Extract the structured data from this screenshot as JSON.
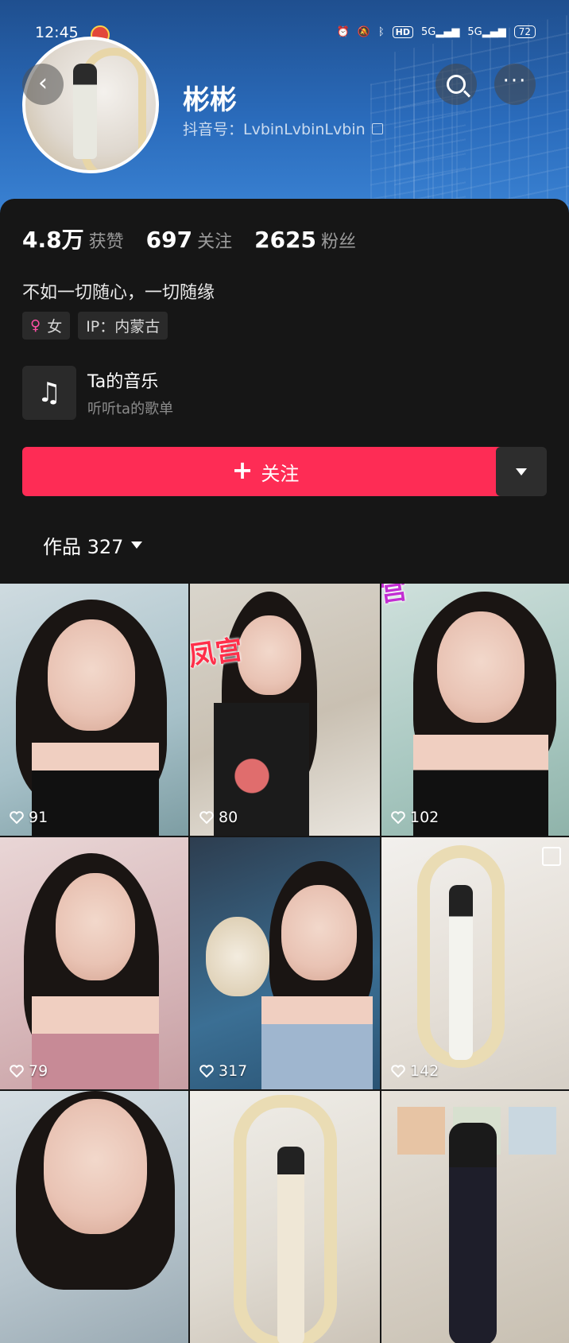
{
  "status_bar": {
    "time": "12:45",
    "hd": "HD",
    "net1": "5G",
    "net2": "5G",
    "battery": "72"
  },
  "profile": {
    "name": "彬彬",
    "douyin_id": "抖音号：LvbinLvbinLvbin",
    "stats": [
      {
        "value": "4.8万",
        "label": "获赞"
      },
      {
        "value": "697",
        "label": "关注"
      },
      {
        "value": "2625",
        "label": "粉丝"
      }
    ],
    "bio": "不如一切随心，一切随缘",
    "gender_tag": "女",
    "ip_tag": "IP：内蒙古"
  },
  "music": {
    "title": "Ta的音乐",
    "subtitle": "听听ta的歌单"
  },
  "buttons": {
    "follow": "关注"
  },
  "works": {
    "label": "作品 327"
  },
  "videos": [
    {
      "likes": "91"
    },
    {
      "likes": "80",
      "watermark_left": "楼凤宫",
      "watermark_right": "楼凤宫"
    },
    {
      "likes": "102"
    },
    {
      "likes": "79"
    },
    {
      "likes": "317"
    },
    {
      "likes": "142"
    },
    {
      "likes": ""
    },
    {
      "likes": ""
    },
    {
      "likes": ""
    }
  ]
}
